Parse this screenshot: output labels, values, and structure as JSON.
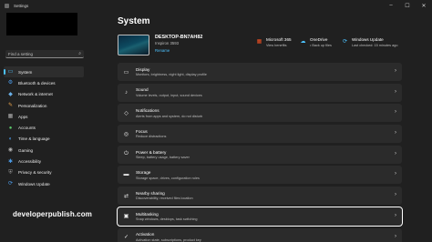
{
  "window": {
    "title": "Settings",
    "controls": {
      "minimize": "–",
      "maximize": "☐",
      "close": "✕"
    }
  },
  "search": {
    "placeholder": "Find a setting",
    "icon": "search-icon"
  },
  "sidebar": {
    "items": [
      {
        "label": "System",
        "icon": "▭",
        "color": "#4cc2ff",
        "active": true
      },
      {
        "label": "Bluetooth & devices",
        "icon": "⚙",
        "color": "#4c9be8"
      },
      {
        "label": "Network & internet",
        "icon": "◆",
        "color": "#6ab0e8"
      },
      {
        "label": "Personalization",
        "icon": "✎",
        "color": "#e8a24c"
      },
      {
        "label": "Apps",
        "icon": "▦",
        "color": "#b0b0b0"
      },
      {
        "label": "Accounts",
        "icon": "●",
        "color": "#5cc96b"
      },
      {
        "label": "Time & language",
        "icon": "◐",
        "color": "#4c9be8"
      },
      {
        "label": "Gaming",
        "icon": "◉",
        "color": "#b0b0b0"
      },
      {
        "label": "Accessibility",
        "icon": "✱",
        "color": "#4c9be8"
      },
      {
        "label": "Privacy & security",
        "icon": "⛨",
        "color": "#9a9a9a"
      },
      {
        "label": "Windows Update",
        "icon": "⟳",
        "color": "#4c9be8"
      }
    ]
  },
  "watermark": "developerpublish.com",
  "main": {
    "title": "System",
    "device": {
      "name": "DESKTOP-BN7AH82",
      "model": "Inspiron 3593",
      "rename": "Rename"
    },
    "quick": [
      {
        "title": "Microsoft 365",
        "sub": "View benefits",
        "icon": "▦",
        "color": "#f25022"
      },
      {
        "title": "OneDrive",
        "sub": "• Back up files",
        "icon": "☁",
        "color": "#4cc2ff"
      },
      {
        "title": "Windows Update",
        "sub": "Last checked: 15 minutes ago",
        "icon": "⟳",
        "color": "#4cc2ff"
      }
    ],
    "cards": [
      {
        "title": "Display",
        "sub": "Monitors, brightness, night light, display profile",
        "icon": "▭"
      },
      {
        "title": "Sound",
        "sub": "Volume levels, output, input, sound devices",
        "icon": "♪"
      },
      {
        "title": "Notifications",
        "sub": "Alerts from apps and system, do not disturb",
        "icon": "◇"
      },
      {
        "title": "Focus",
        "sub": "Reduce distractions",
        "icon": "◎"
      },
      {
        "title": "Power & battery",
        "sub": "Sleep, battery usage, battery saver",
        "icon": "⏻"
      },
      {
        "title": "Storage",
        "sub": "Storage space, drives, configuration rules",
        "icon": "▬"
      },
      {
        "title": "Nearby sharing",
        "sub": "Discoverability, received files location",
        "icon": "⇄"
      },
      {
        "title": "Multitasking",
        "sub": "Snap windows, desktops, task switching",
        "icon": "▣",
        "selected": true
      },
      {
        "title": "Activation",
        "sub": "Activation state, subscriptions, product key",
        "icon": "✓"
      }
    ],
    "chevron": "›"
  }
}
